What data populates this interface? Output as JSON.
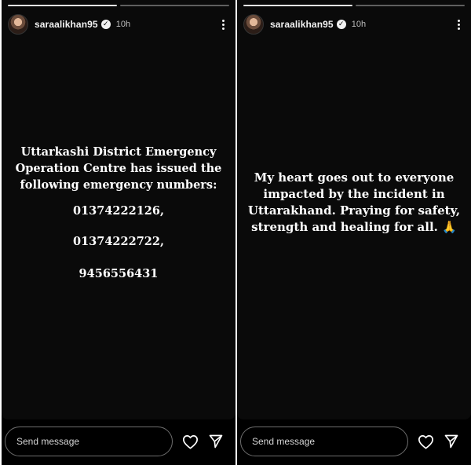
{
  "stories": [
    {
      "username": "saraalikhan95",
      "time": "10h",
      "headline": "Uttarkashi District Emergency Operation Centre has issued the following emergency numbers:",
      "numbers": [
        "01374222126,",
        "01374222722,",
        "9456556431"
      ],
      "composer": {
        "placeholder": "Send message"
      },
      "icons": {
        "heart": "heart-icon",
        "send": "send-icon",
        "more": "more-vertical-icon",
        "verified": "verified-badge-icon"
      }
    },
    {
      "username": "saraalikhan95",
      "time": "10h",
      "message": "My heart goes out to everyone impacted by the incident in Uttarakhand. Praying for safety, strength and healing for all.",
      "emoji": "🙏",
      "composer": {
        "placeholder": "Send message"
      },
      "icons": {
        "heart": "heart-icon",
        "send": "send-icon",
        "more": "more-vertical-icon",
        "verified": "verified-badge-icon"
      }
    }
  ],
  "colors": {
    "background": "#000000",
    "story_bg": "#0a0a0a",
    "text": "#ffffff",
    "border": "#6e6e6e"
  }
}
